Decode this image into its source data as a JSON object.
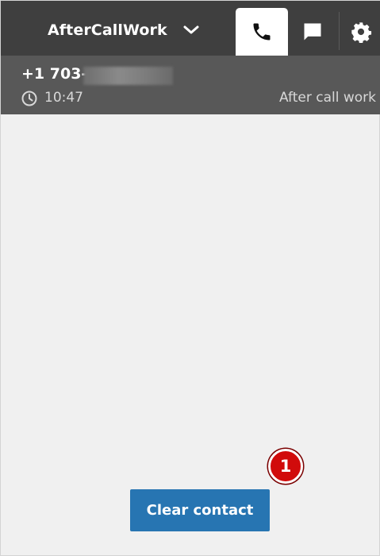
{
  "header": {
    "status": "AfterCallWork",
    "tabs": [
      {
        "name": "phone",
        "icon": "phone-icon",
        "active": true
      },
      {
        "name": "chat",
        "icon": "chat-icon",
        "active": false
      },
      {
        "name": "settings",
        "icon": "gear-icon",
        "active": false
      }
    ]
  },
  "contact": {
    "phone_number": "+1 703-",
    "duration": "10:47",
    "state": "After call work"
  },
  "actions": {
    "clear_contact": "Clear contact"
  },
  "annotation": {
    "marker": "1",
    "color": "#d10b0b"
  },
  "colors": {
    "topbar": "#3f3f3f",
    "contactbar": "#585858",
    "body": "#f0f0f0",
    "button": "#2775b2"
  }
}
